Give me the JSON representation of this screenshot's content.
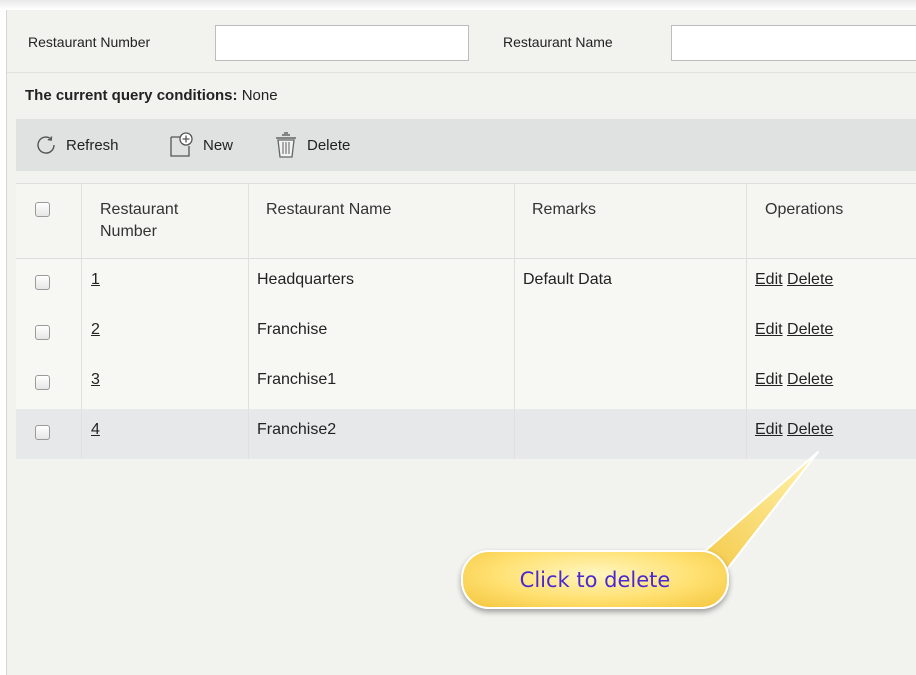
{
  "query": {
    "restaurant_number_label": "Restaurant Number",
    "restaurant_number_value": "",
    "restaurant_name_label": "Restaurant Name",
    "restaurant_name_value": ""
  },
  "conditions": {
    "label": "The current query conditions:",
    "value": "None"
  },
  "toolbar": {
    "refresh_label": "Refresh",
    "new_label": "New",
    "delete_label": "Delete",
    "refresh_icon": "refresh-icon",
    "new_icon": "new-document-icon",
    "delete_icon": "trash-icon"
  },
  "table": {
    "columns": [
      "Restaurant\nNumber",
      "Restaurant Name",
      "Remarks",
      "Operations"
    ],
    "rows": [
      {
        "number": "1",
        "name": "Headquarters",
        "remarks": "Default Data",
        "edit": "Edit",
        "delete": "Delete"
      },
      {
        "number": "2",
        "name": "Franchise",
        "remarks": "",
        "edit": "Edit",
        "delete": "Delete"
      },
      {
        "number": "3",
        "name": "Franchise1",
        "remarks": "",
        "edit": "Edit",
        "delete": "Delete"
      },
      {
        "number": "4",
        "name": "Franchise2",
        "remarks": "",
        "edit": "Edit",
        "delete": "Delete"
      }
    ]
  },
  "callout": {
    "text": "Click to delete"
  },
  "colors": {
    "panel_bg": "#f2f3ef",
    "toolbar_bg": "#dfe2e1",
    "highlight_row": "#e7e8ea",
    "callout_text": "#4a2ad0",
    "callout_fill": "#ffe070"
  }
}
